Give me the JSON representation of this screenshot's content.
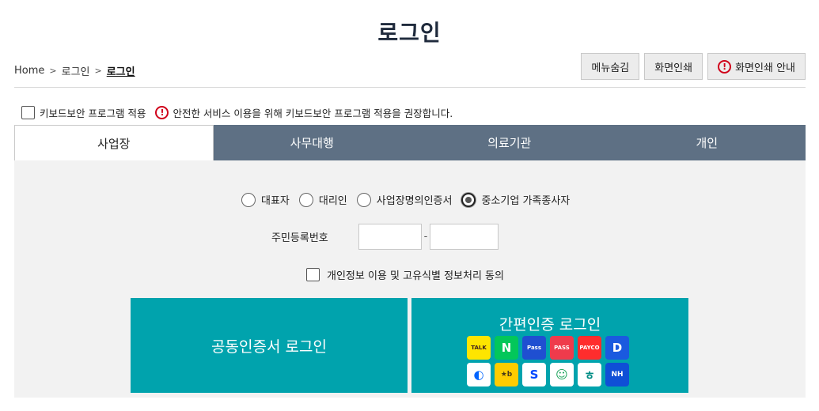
{
  "page": {
    "title": "로그인"
  },
  "breadcrumb": {
    "items": [
      "Home",
      "로그인"
    ],
    "current": "로그인"
  },
  "top_buttons": {
    "hide_menu": "메뉴숨김",
    "print": "화면인쇄",
    "print_guide": "화면인쇄 안내"
  },
  "keyboard_security": {
    "label": "키보드보안 프로그램 적용",
    "notice": "안전한 서비스 이용을 위해 키보드보안 프로그램 적용을 권장합니다."
  },
  "tabs": [
    {
      "label": "사업장",
      "active": true
    },
    {
      "label": "사무대행",
      "active": false
    },
    {
      "label": "의료기관",
      "active": false
    },
    {
      "label": "개인",
      "active": false
    }
  ],
  "login_types": {
    "options": [
      "대표자",
      "대리인",
      "사업장명의인증서",
      "중소기업 가족종사자"
    ],
    "selected": "중소기업 가족종사자"
  },
  "rrn": {
    "label": "주민등록번호",
    "first": "",
    "second": "",
    "separator": "-"
  },
  "privacy_consent": {
    "label": "개인정보 이용 및 고유식별 정보처리 동의"
  },
  "cert_login": {
    "label": "공동인증서 로그인"
  },
  "simple_login": {
    "label": "간편인증 로그인",
    "providers": [
      {
        "name": "kakao",
        "text": "TALK",
        "bg": "#fee500",
        "fg": "#3c1e1e"
      },
      {
        "name": "naver",
        "text": "N",
        "bg": "#03c75a",
        "fg": "#ffffff"
      },
      {
        "name": "samsung-pass",
        "text": "Pass",
        "bg": "#1f4fd1",
        "fg": "#ffffff"
      },
      {
        "name": "pass",
        "text": "PASS",
        "bg": "#ef3b4c",
        "fg": "#ffffff"
      },
      {
        "name": "payco",
        "text": "PAYCO",
        "bg": "#ff2d2d",
        "fg": "#ffffff"
      },
      {
        "name": "dream",
        "text": "D",
        "bg": "#1a5adf",
        "fg": "#ffffff"
      },
      {
        "name": "toss",
        "text": "◐",
        "bg": "#ffffff",
        "fg": "#0064ff"
      },
      {
        "name": "kb",
        "text": "★b",
        "bg": "#ffcc00",
        "fg": "#4a3b1a"
      },
      {
        "name": "shinhan",
        "text": "S",
        "bg": "#ffffff",
        "fg": "#0046ff"
      },
      {
        "name": "woori",
        "text": "☺",
        "bg": "#ffffff",
        "fg": "#1aa35a"
      },
      {
        "name": "hana",
        "text": "ㅎ",
        "bg": "#ffffff",
        "fg": "#008c84"
      },
      {
        "name": "nh",
        "text": "NH",
        "bg": "#0f4fd6",
        "fg": "#ffffff"
      }
    ]
  },
  "colors": {
    "accent": "#00a3ad",
    "tab_bg": "#5e7084",
    "alert": "#d0021b",
    "panel_bg": "#f2f2f2"
  }
}
